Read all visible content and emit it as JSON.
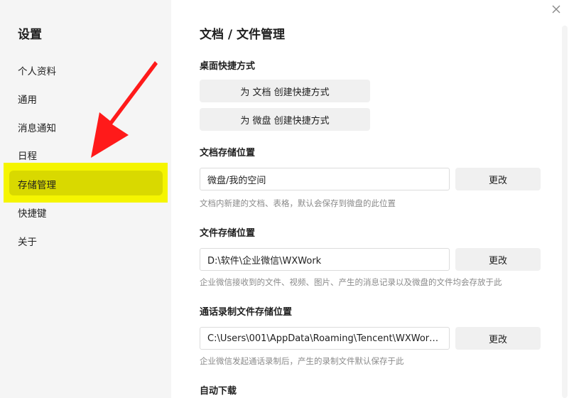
{
  "sidebar": {
    "title": "设置",
    "items": [
      {
        "label": "个人资料"
      },
      {
        "label": "通用"
      },
      {
        "label": "消息通知"
      },
      {
        "label": "日程"
      },
      {
        "label": "存储管理",
        "active": true
      },
      {
        "label": "快捷键"
      },
      {
        "label": "关于"
      }
    ]
  },
  "main": {
    "title": "文档 / 文件管理",
    "desktop_shortcut": {
      "title": "桌面快捷方式",
      "doc_button": "为 文档 创建快捷方式",
      "drive_button": "为 微盘 创建快捷方式"
    },
    "doc_storage": {
      "title": "文档存储位置",
      "path": "微盘/我的空间",
      "change": "更改",
      "hint": "文档内新建的文档、表格，默认会保存到微盘的此位置"
    },
    "file_storage": {
      "title": "文件存储位置",
      "path": "D:\\软件\\企业微信\\WXWork",
      "change": "更改",
      "hint": "企业微信接收到的文件、视频、图片、产生的消息记录以及微盘的文件均会存放于此"
    },
    "call_storage": {
      "title": "通话录制文件存储位置",
      "path": "C:\\Users\\001\\AppData\\Roaming\\Tencent\\WXWork\\V...",
      "change": "更改",
      "hint": "企业微信发起通话录制后，产生的录制文件默认保存于此"
    },
    "auto_download": {
      "title": "自动下载"
    }
  },
  "colors": {
    "sidebar_bg": "#f5f5f5",
    "highlight": "#f5f500",
    "active_item": "#d9d900",
    "arrow": "#ff0000",
    "button_bg": "#f0f0f0",
    "hint_text": "#8a8a8a"
  },
  "icons": {
    "close": "close-icon",
    "annotation": "red-arrow-icon"
  }
}
